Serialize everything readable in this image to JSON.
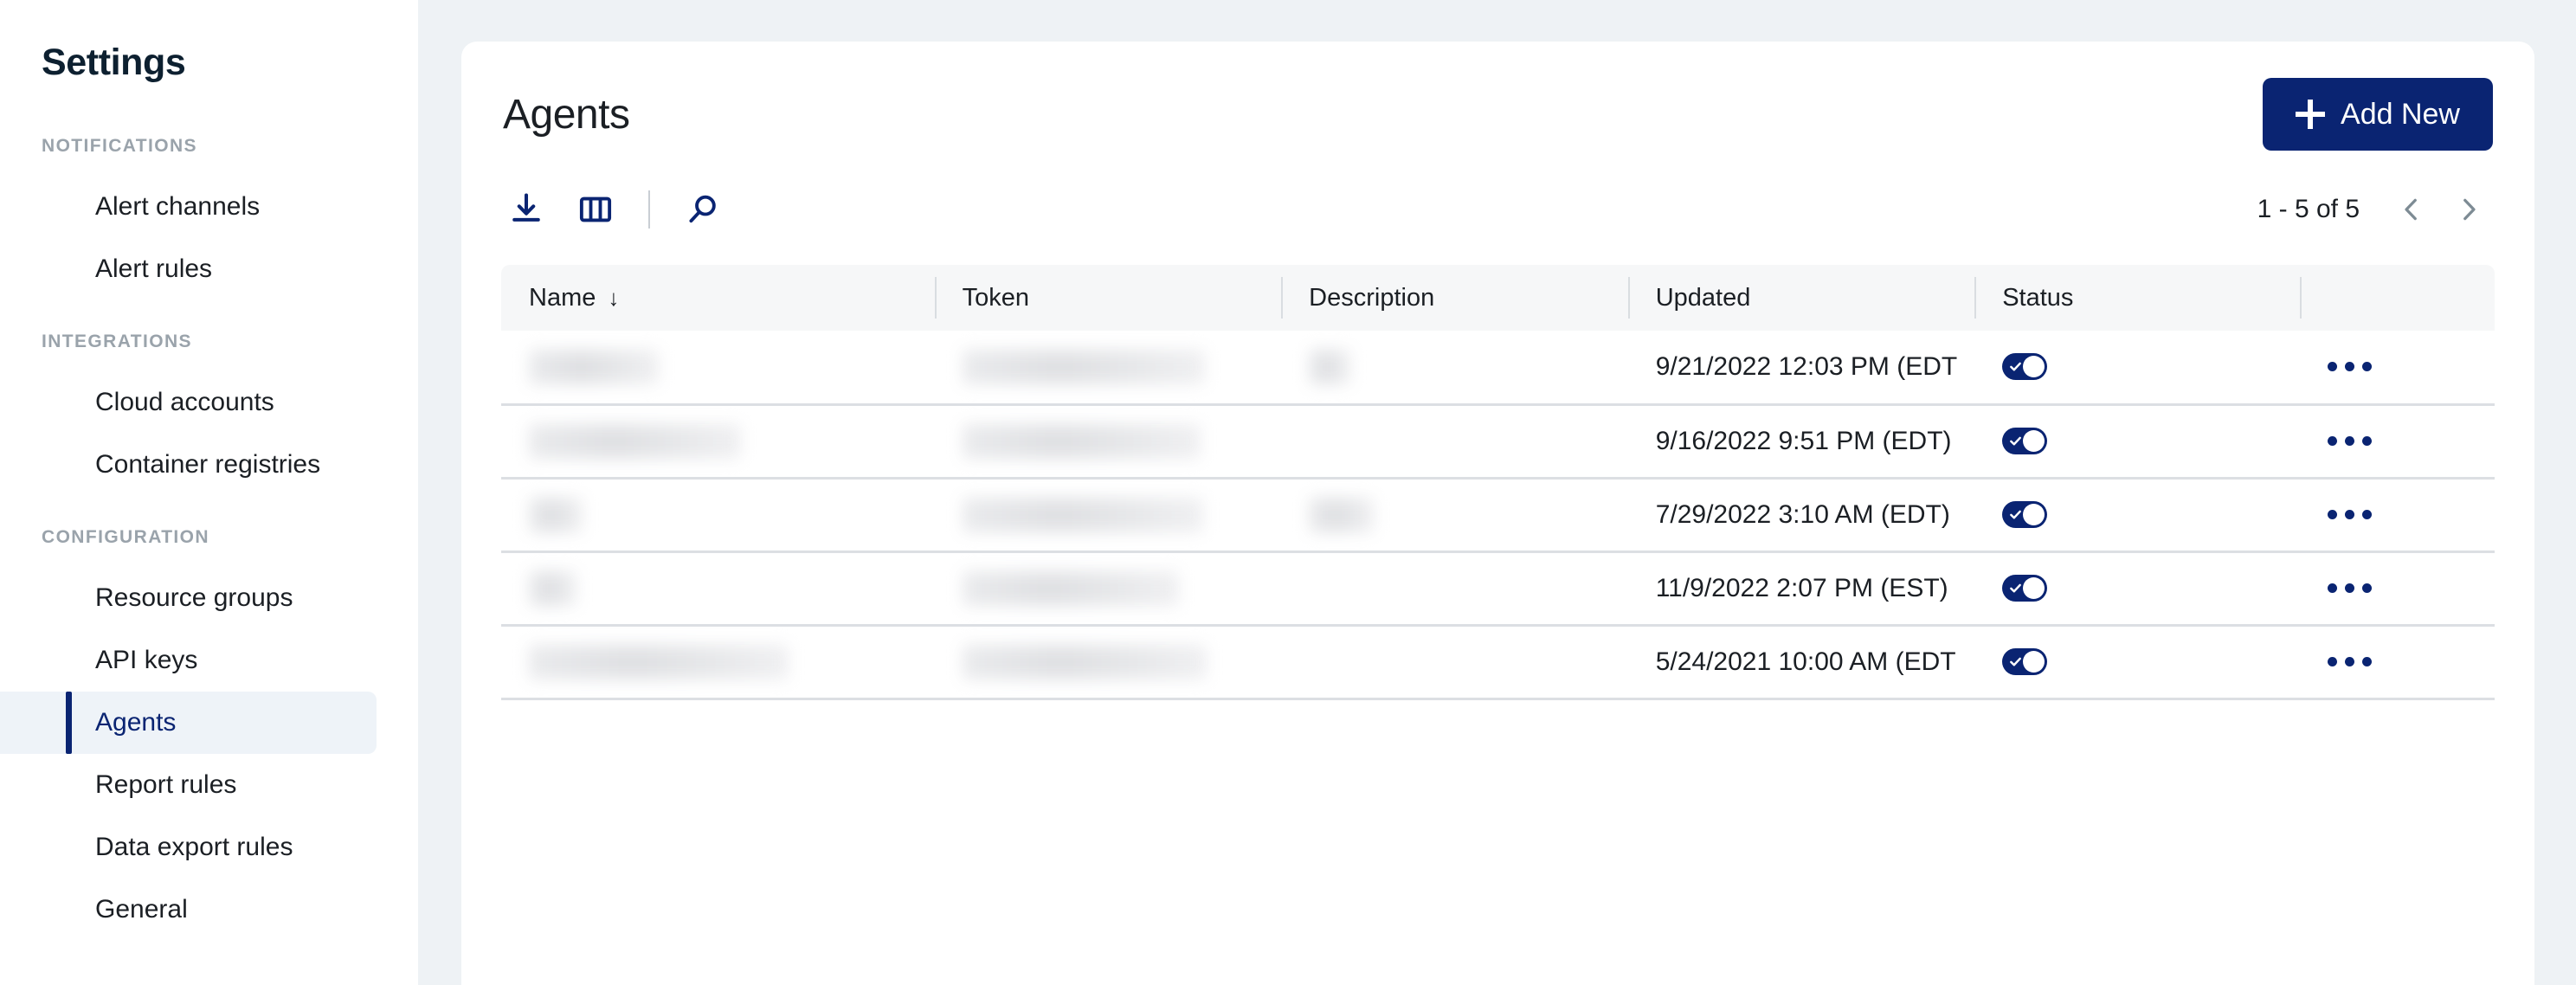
{
  "sidebar": {
    "title": "Settings",
    "groups": [
      {
        "label": "NOTIFICATIONS",
        "items": [
          {
            "label": "Alert channels",
            "active": false
          },
          {
            "label": "Alert rules",
            "active": false
          }
        ]
      },
      {
        "label": "INTEGRATIONS",
        "items": [
          {
            "label": "Cloud accounts",
            "active": false
          },
          {
            "label": "Container registries",
            "active": false
          }
        ]
      },
      {
        "label": "CONFIGURATION",
        "items": [
          {
            "label": "Resource groups",
            "active": false
          },
          {
            "label": "API keys",
            "active": false
          },
          {
            "label": "Agents",
            "active": true
          },
          {
            "label": "Report rules",
            "active": false
          },
          {
            "label": "Data export rules",
            "active": false
          },
          {
            "label": "General",
            "active": false
          }
        ]
      }
    ]
  },
  "header": {
    "title": "Agents",
    "add_new_label": "Add New",
    "add_new_icon": "plus-icon",
    "accent_color": "#0a2472"
  },
  "toolbar": {
    "download_icon": "download-icon",
    "columns_icon": "columns-icon",
    "search_icon": "search-icon",
    "pagination_label": "1 - 5 of 5",
    "prev_icon": "chevron-left-icon",
    "next_icon": "chevron-right-icon"
  },
  "table": {
    "columns": [
      {
        "label": "Name",
        "sort": "↓"
      },
      {
        "label": "Token",
        "sort": ""
      },
      {
        "label": "Description",
        "sort": ""
      },
      {
        "label": "Updated",
        "sort": ""
      },
      {
        "label": "Status",
        "sort": ""
      },
      {
        "label": "",
        "sort": ""
      }
    ],
    "rows": [
      {
        "name": "",
        "token": "",
        "description": "",
        "updated": "9/21/2022 12:03 PM (EDT",
        "status_on": true,
        "name_w": 150,
        "token_w": 280,
        "desc_w": 48
      },
      {
        "name": "",
        "token": "",
        "description": "",
        "updated": "9/16/2022 9:51 PM (EDT)",
        "status_on": true,
        "name_w": 245,
        "token_w": 275,
        "desc_w": 0
      },
      {
        "name": "",
        "token": "",
        "description": "",
        "updated": "7/29/2022 3:10 AM (EDT)",
        "status_on": true,
        "name_w": 62,
        "token_w": 278,
        "desc_w": 75
      },
      {
        "name": "",
        "token": "",
        "description": "",
        "updated": "11/9/2022 2:07 PM (EST)",
        "status_on": true,
        "name_w": 55,
        "token_w": 250,
        "desc_w": 0
      },
      {
        "name": "",
        "token": "",
        "description": "",
        "updated": "5/24/2021 10:00 AM (EDT",
        "status_on": true,
        "name_w": 300,
        "token_w": 282,
        "desc_w": 0
      }
    ],
    "row_menu_icon": "more-options-icon",
    "toggle_icon": "toggle-on-icon"
  }
}
